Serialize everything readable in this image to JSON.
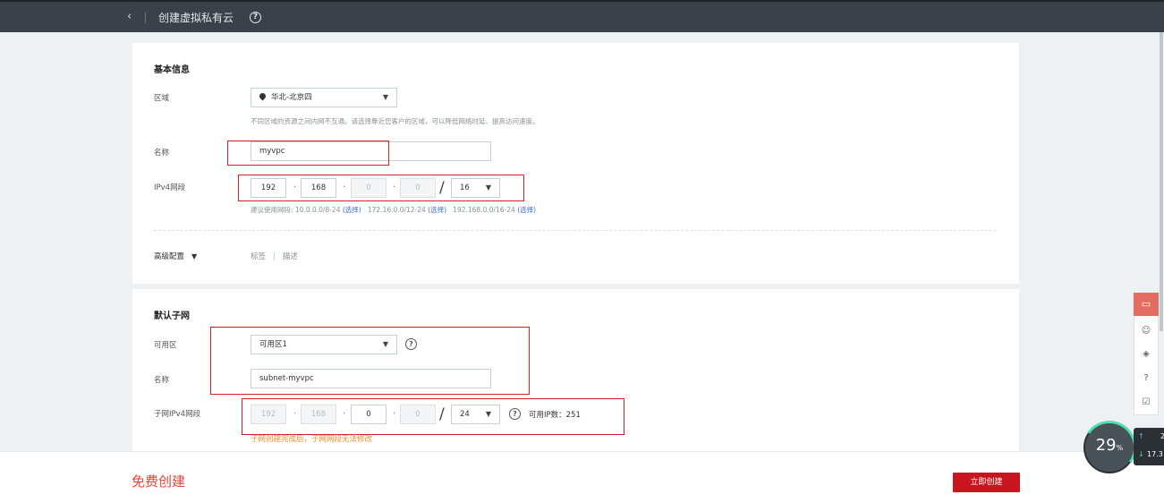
{
  "header": {
    "back_icon": "chevron-left-icon",
    "title": "创建虚拟私有云",
    "help_icon": "question-circle-icon"
  },
  "basic": {
    "section_title": "基本信息",
    "region_label": "区域",
    "region_value": "华北-北京四",
    "region_hint": "不同区域的资源之间内网不互通。请选择靠近您客户的区域，可以降低网络时延、提高访问速度。",
    "name_label": "名称",
    "name_value": "myvpc",
    "ipv4_label": "IPv4网段",
    "ip": [
      "192",
      "168",
      "0",
      "0"
    ],
    "mask": "16",
    "suggest_prefix": "建议使用网段: 10.0.0.0/8-24",
    "suggest_2": "172.16.0.0/12-24",
    "suggest_3": "192.168.0.0/16-24",
    "select_link": "(选择)",
    "advanced_label": "高级配置",
    "tag_label": "标签",
    "desc_label": "描述"
  },
  "subnet": {
    "section_title": "默认子网",
    "az_label": "可用区",
    "az_value": "可用区1",
    "name_label": "名称",
    "name_value": "subnet-myvpc",
    "ipv4_label": "子网IPv4网段",
    "ip": [
      "192",
      "168",
      "0",
      "0"
    ],
    "mask": "24",
    "available_ip": "可用IP数：251",
    "warning": "子网创建完成后，子网网段无法修改"
  },
  "footer": {
    "free_label": "免费创建",
    "create_button": "立即创建"
  },
  "widget": {
    "percent": "29",
    "percent_unit": "%",
    "up_value": "2",
    "down_value": "17.3"
  },
  "colors": {
    "accent_red": "#c8151f",
    "topbar": "#3a4148"
  }
}
